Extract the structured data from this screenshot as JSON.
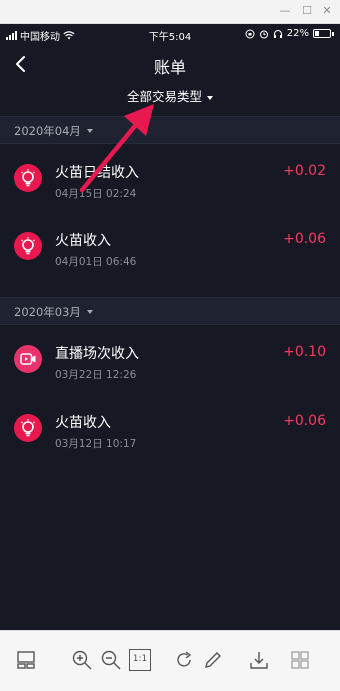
{
  "status_bar": {
    "carrier": "中国移动",
    "time": "下午5:04",
    "battery": "22%"
  },
  "header": {
    "title": "账单"
  },
  "filter": {
    "label": "全部交易类型"
  },
  "groups": [
    {
      "month": "2020年04月",
      "items": [
        {
          "name": "火苗日结收入",
          "time": "04月15日 02:24",
          "amount": "+0.02",
          "icon": "flame-bulb-icon"
        },
        {
          "name": "火苗收入",
          "time": "04月01日 06:46",
          "amount": "+0.06",
          "icon": "flame-bulb-icon"
        }
      ]
    },
    {
      "month": "2020年03月",
      "items": [
        {
          "name": "直播场次收入",
          "time": "03月22日 12:26",
          "amount": "+0.10",
          "icon": "video-camera-icon"
        },
        {
          "name": "火苗收入",
          "time": "03月12日 10:17",
          "amount": "+0.06",
          "icon": "flame-bulb-icon"
        }
      ]
    }
  ],
  "viewer_toolbar": {
    "actual_size_label": "1:1"
  },
  "colors": {
    "background": "#161823",
    "accent": "#e8194f",
    "amount": "#f23d60",
    "annotation_arrow": "#e8194f"
  }
}
